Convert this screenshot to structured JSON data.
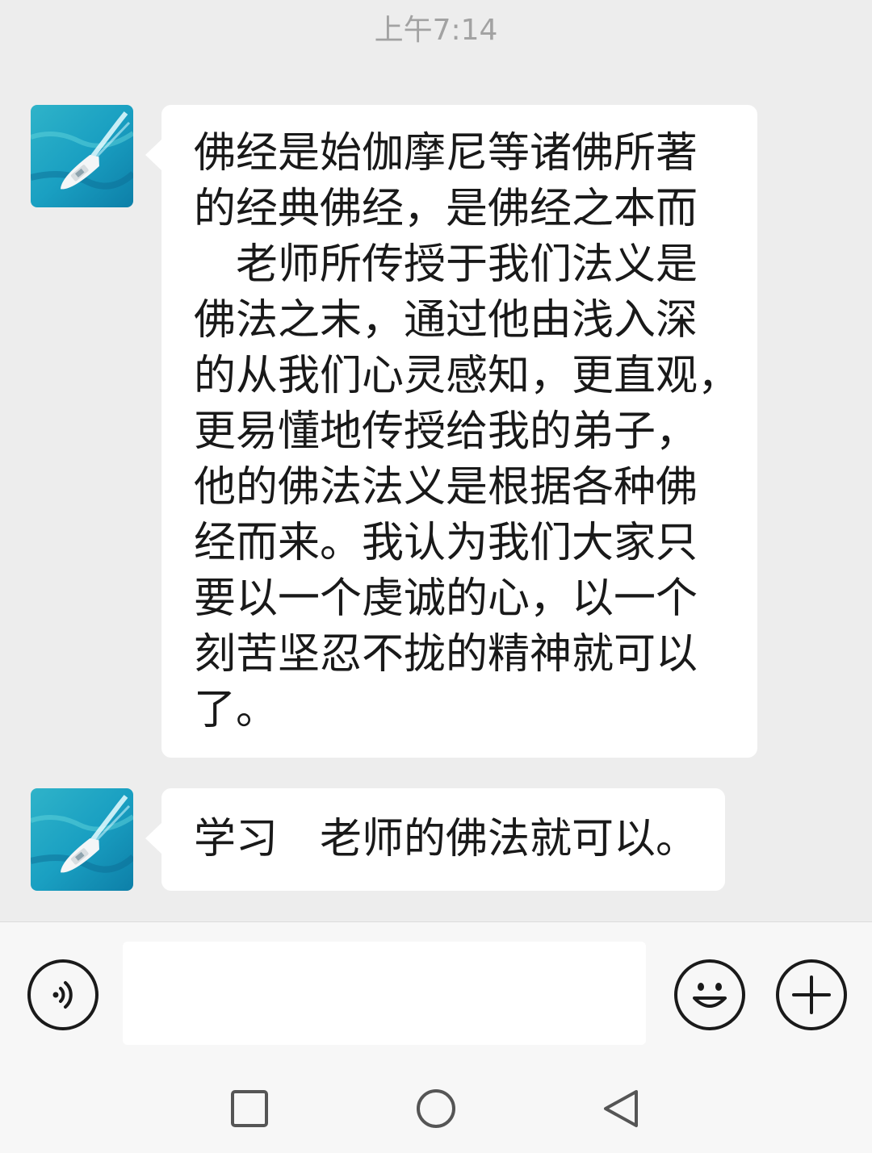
{
  "timestamp": "上午7:14",
  "messages": [
    {
      "lines": [
        "佛经是始伽摩尼等诸佛所著",
        "的经典佛经，是佛经之本而",
        "　老师所传授于我们法义是",
        "佛法之末，通过他由浅入深",
        "的从我们心灵感知，更直观，",
        "更易懂地传授给我的弟子，",
        "他的佛法法义是根据各种佛",
        "经而来。我认为我们大家只",
        "要以一个虔诚的心，以一个",
        "刻苦坚忍不拢的精神就可以",
        "了。"
      ]
    },
    {
      "lines": [
        "学习　老师的佛法就可以。"
      ]
    }
  ],
  "composer": {
    "voice_icon": "voice-wave-icon",
    "emoji_icon": "smiley-face-icon",
    "more_icon": "plus-icon",
    "input_value": ""
  },
  "navbar": {
    "recent_icon": "square-icon",
    "home_icon": "circle-icon",
    "back_icon": "triangle-back-icon"
  },
  "colors": {
    "background": "#ededed",
    "bubble": "#ffffff",
    "timestamp": "#a2a2a2",
    "text": "#191919"
  }
}
